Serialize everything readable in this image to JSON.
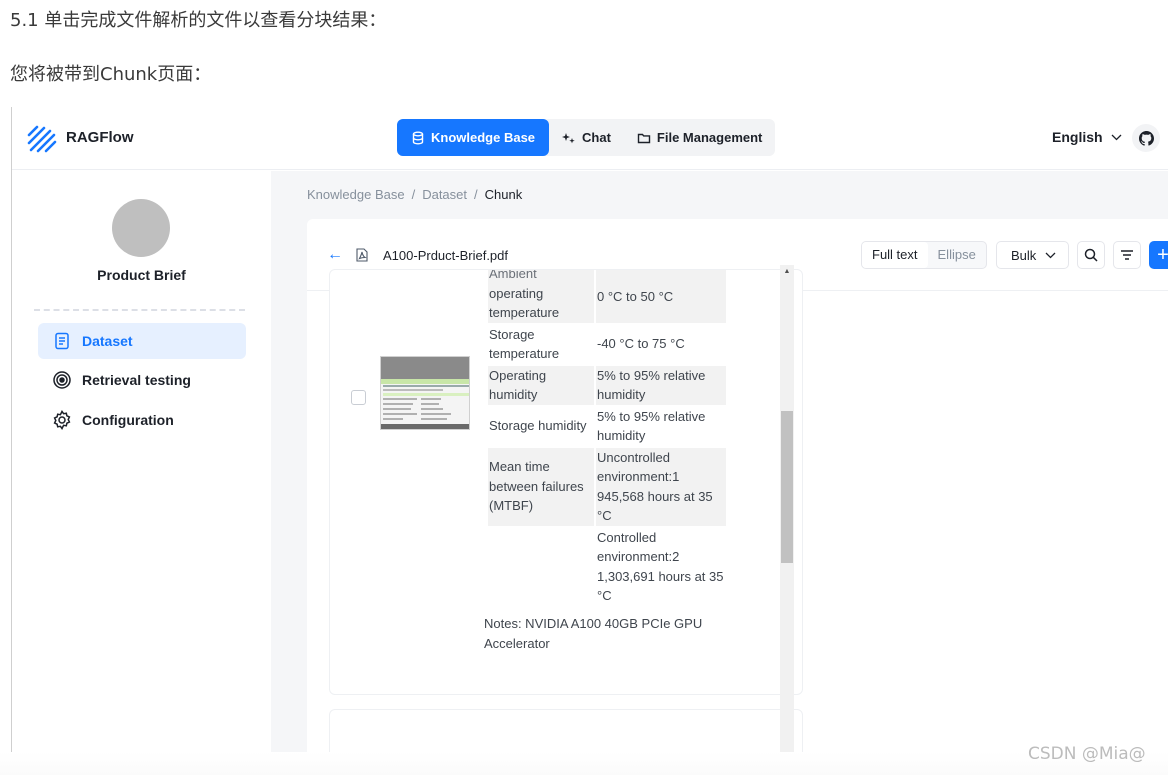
{
  "doc": {
    "line1": "5.1 单击完成文件解析的文件以查看分块结果：",
    "line2": "您将被带到Chunk页面："
  },
  "header": {
    "brand": "RAGFlow",
    "nav": [
      {
        "label": "Knowledge Base",
        "icon": "database-icon",
        "active": true
      },
      {
        "label": "Chat",
        "icon": "chat-icon",
        "active": false
      },
      {
        "label": "File Management",
        "icon": "folder-icon",
        "active": false
      }
    ],
    "language": "English",
    "accent": "#1677ff"
  },
  "sidebar": {
    "kb_name": "Product Brief",
    "items": [
      {
        "label": "Dataset",
        "icon": "document-icon",
        "active": true
      },
      {
        "label": "Retrieval testing",
        "icon": "target-icon",
        "active": false
      },
      {
        "label": "Configuration",
        "icon": "gear-icon",
        "active": false
      }
    ]
  },
  "breadcrumb": {
    "items": [
      "Knowledge Base",
      "Dataset",
      "Chunk"
    ],
    "separator": "/"
  },
  "toolbar": {
    "file_name": "A100-Prduct-Brief.pdf",
    "view_modes": [
      "Full text",
      "Ellipse"
    ],
    "selected_view": "Full text",
    "bulk_label": "Bulk",
    "add_label": "+"
  },
  "chunk": {
    "partial_top": "Ambient",
    "rows": [
      {
        "key": "operating temperature",
        "value": "0 °C to 50 °C"
      },
      {
        "key": "Storage temperature",
        "value": "-40 °C to 75 °C"
      },
      {
        "key": "Operating humidity",
        "value": "5% to 95% relative humidity"
      },
      {
        "key": "Storage humidity",
        "value": "5% to 95% relative humidity"
      },
      {
        "key": "Mean time between failures (MTBF)",
        "value": "Uncontrolled environment:1 945,568 hours at 35 °C"
      },
      {
        "key": "",
        "value": "Controlled environment:2 1,303,691 hours at 35 °C"
      }
    ],
    "notes": "Notes: NVIDIA A100 40GB PCIe GPU Accelerator"
  },
  "watermark": "CSDN @Mia@"
}
